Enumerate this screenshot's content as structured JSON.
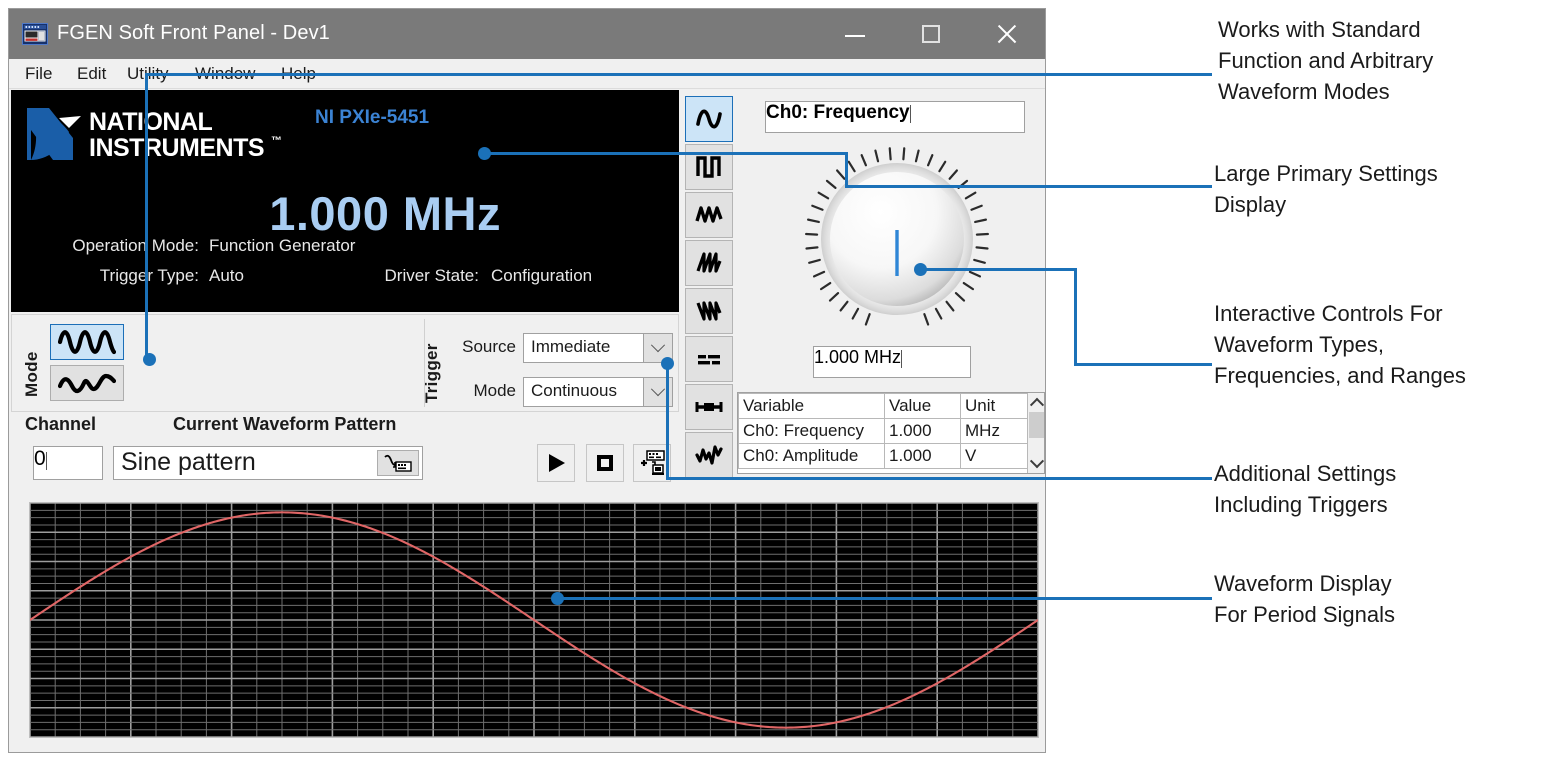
{
  "window": {
    "title": "FGEN Soft Front Panel - Dev1",
    "title_icon": "instrument-panel-icon",
    "controls": {
      "minimize": "minimize-icon",
      "maximize": "maximize-icon",
      "close": "close-icon"
    },
    "menu": [
      "File",
      "Edit",
      "Utility",
      "Window",
      "Help"
    ]
  },
  "display": {
    "brand": "NATIONAL INSTRUMENTS",
    "brand_tm": "™",
    "model": "NI PXIe-5451",
    "primary_value": "1.000 MHz",
    "fields": [
      {
        "label": "Operation Mode:",
        "value": "Function Generator"
      },
      {
        "label": "Trigger Type:",
        "value": "Auto"
      },
      {
        "label": "Driver State:",
        "value": "Configuration"
      }
    ]
  },
  "mode": {
    "group_label": "Mode",
    "buttons": [
      {
        "name": "standard-function-mode",
        "icon": "sine-burst-icon",
        "selected": true
      },
      {
        "name": "arbitrary-waveform-mode",
        "icon": "arbitrary-wave-icon",
        "selected": false
      }
    ]
  },
  "trigger": {
    "group_label": "Trigger",
    "source": {
      "label": "Source",
      "value": "Immediate"
    },
    "mode": {
      "label": "Mode",
      "value": "Continuous"
    }
  },
  "channel": {
    "label": "Channel",
    "value": "0",
    "pattern_label": "Current Waveform Pattern",
    "pattern_value": "Sine pattern",
    "pattern_button_icon": "waveform-editor-icon"
  },
  "transport": [
    {
      "name": "run-button",
      "icon": "play-icon"
    },
    {
      "name": "stop-button",
      "icon": "stop-icon"
    },
    {
      "name": "device-to-pc-button",
      "icon": "device-transfer-icon"
    }
  ],
  "waveform_buttons": [
    {
      "name": "waveform-sine",
      "icon": "sine-icon",
      "selected": true
    },
    {
      "name": "waveform-square",
      "icon": "square-icon",
      "selected": false
    },
    {
      "name": "waveform-triangle",
      "icon": "triangle-icon",
      "selected": false
    },
    {
      "name": "waveform-sawtooth-up",
      "icon": "sawtooth-up-icon",
      "selected": false
    },
    {
      "name": "waveform-sawtooth-down",
      "icon": "sawtooth-down-icon",
      "selected": false
    },
    {
      "name": "waveform-dc",
      "icon": "dc-level-icon",
      "selected": false
    },
    {
      "name": "waveform-pulse",
      "icon": "pulse-icon",
      "selected": false
    },
    {
      "name": "waveform-arbitrary",
      "icon": "arbitrary-icon",
      "selected": false
    }
  ],
  "settings": {
    "selector_value": "Ch0: Frequency",
    "knob_name": "frequency-knob",
    "knob_value_display": "1.000 MHz"
  },
  "variable_table": {
    "headers": [
      "Variable",
      "Value",
      "Unit"
    ],
    "rows": [
      [
        "Ch0: Frequency",
        "1.000",
        "MHz"
      ],
      [
        "Ch0: Amplitude",
        "1.000",
        "V"
      ]
    ],
    "scroll_up_icon": "chevron-up-icon",
    "scroll_down_icon": "chevron-down-icon"
  },
  "chart_data": {
    "type": "line",
    "title": "",
    "xlabel": "",
    "ylabel": "",
    "series": [
      {
        "name": "Sine pattern",
        "color": "#e06666",
        "cycles": 1,
        "amplitude": 1.0,
        "phase_deg": 0
      }
    ],
    "xlim": [
      0,
      1
    ],
    "ylim": [
      -1,
      1
    ],
    "grid": true,
    "grid_color": "#8c8c8c",
    "background": "#000000",
    "major_divisions_x": 10,
    "major_divisions_y": 8,
    "minor_per_major": 4
  },
  "colors": {
    "accent": "#1b71b8",
    "ni_blue": "#1a5ea8",
    "display_value": "#a9cdf2",
    "trace": "#e06666",
    "titlebar": "#7a7a7a"
  },
  "annotations": [
    {
      "name": "annotation-modes",
      "lines": [
        "Works with Standard",
        "Function and Arbitrary",
        "Waveform Modes"
      ]
    },
    {
      "name": "annotation-primary-display",
      "lines": [
        "Large Primary Settings",
        "Display"
      ]
    },
    {
      "name": "annotation-interactive-controls",
      "lines": [
        "Interactive Controls For",
        "Waveform Types,",
        "Frequencies, and Ranges"
      ]
    },
    {
      "name": "annotation-additional-settings",
      "lines": [
        "Additional Settings",
        "Including Triggers"
      ]
    },
    {
      "name": "annotation-waveform-display",
      "lines": [
        "Waveform Display",
        "For Period Signals"
      ]
    }
  ]
}
